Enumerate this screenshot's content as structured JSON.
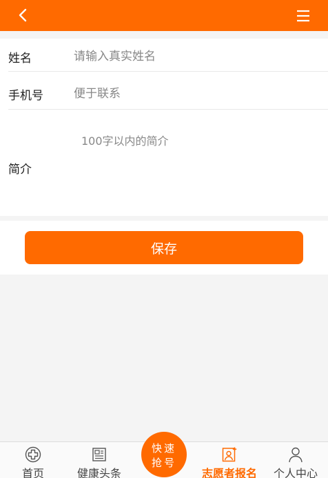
{
  "header": {
    "back_icon": "chevron-left-icon",
    "menu_icon": "hamburger-menu-icon",
    "color": "#ff6a00"
  },
  "form": {
    "name": {
      "label": "姓名",
      "placeholder": "请输入真实姓名"
    },
    "phone": {
      "label": "手机号",
      "placeholder": "便于联系"
    },
    "bio": {
      "label": "简介",
      "placeholder": "100字以内的简介"
    }
  },
  "save_label": "保存",
  "tabbar": {
    "home": "首页",
    "news": "健康头条",
    "quick_line1": "快速",
    "quick_line2": "抢号",
    "volunteer": "志愿者报名",
    "me": "个人中心"
  },
  "accent": "#ff6a00"
}
